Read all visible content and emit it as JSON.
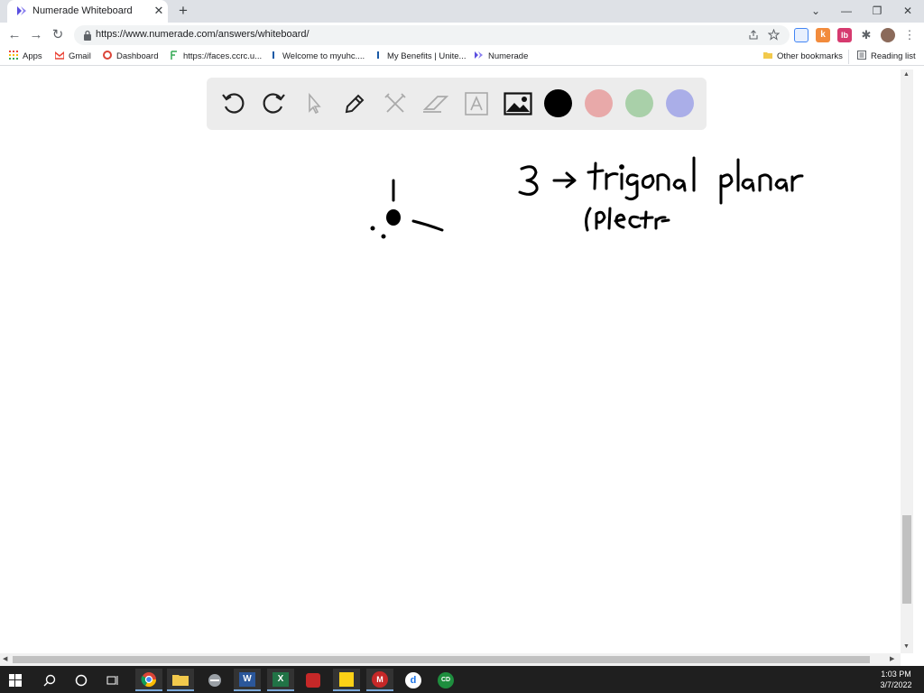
{
  "browser": {
    "tab_title": "Numerade Whiteboard",
    "tab_close": "✕",
    "new_tab": "+",
    "url": "https://www.numerade.com/answers/whiteboard/",
    "window_controls": {
      "minimize": "—",
      "restore": "❐",
      "close": "✕"
    }
  },
  "bookmarks": {
    "items": [
      {
        "label": "Apps",
        "icon": "apps-grid-icon",
        "color": "#ea4335"
      },
      {
        "label": "Gmail",
        "icon": "gmail-icon",
        "color": "#ea4335"
      },
      {
        "label": "Dashboard",
        "icon": "dashboard-icon",
        "color": "#db4437"
      },
      {
        "label": "https://faces.ccrc.u...",
        "icon": "faces-icon",
        "color": "#34a853"
      },
      {
        "label": "Welcome to myuhc....",
        "icon": "uhc-icon",
        "color": "#1a5aa6"
      },
      {
        "label": "My Benefits | Unite...",
        "icon": "benefits-icon",
        "color": "#1a5aa6"
      },
      {
        "label": "Numerade",
        "icon": "numerade-icon",
        "color": "#5a4fe0"
      }
    ],
    "other": "Other bookmarks",
    "reading_list": "Reading list"
  },
  "whiteboard": {
    "tools": [
      "undo-icon",
      "redo-icon",
      "pointer-icon",
      "pen-icon",
      "tools-icon",
      "eraser-icon",
      "text-icon",
      "image-icon"
    ],
    "colors": [
      "#000000",
      "#e8a9a9",
      "#a9d0a9",
      "#aaaee8"
    ]
  },
  "clock": {
    "time": "1:03 PM",
    "date": "3/7/2022"
  }
}
